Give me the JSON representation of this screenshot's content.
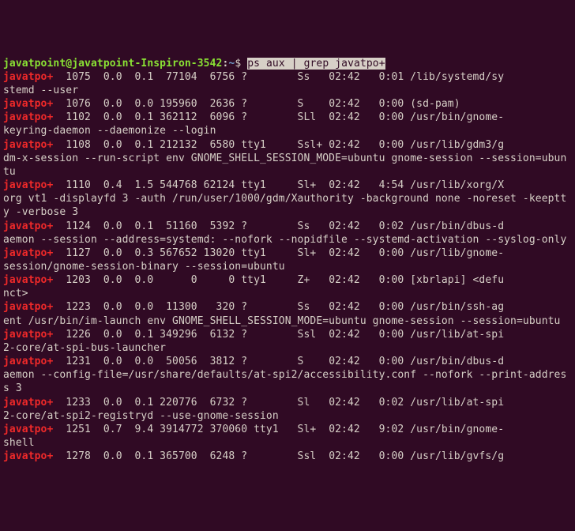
{
  "prompt": {
    "userhost": "javatpoint@javatpoint-Inspiron-3542",
    "colon": ":",
    "path": "~",
    "dollar": "$"
  },
  "cmd": {
    "ps": "ps",
    "space1": " ",
    "aux": "aux",
    "space2": " ",
    "pipe": "|",
    "space3": " ",
    "grep": "grep",
    "space4": " ",
    "javat": "javatpo+"
  },
  "r": [
    {
      "m": "javatpo+",
      "mid": "  1075  0.0  0.1  77104  6756 ?        Ss   02:42   0:01 /lib/systemd/sy",
      "rest": "stemd --user"
    },
    {
      "m": "javatpo+",
      "mid": "  1076  0.0  0.0 195960  2636 ?        S    02:42   0:00 (sd-pam)",
      "rest": ""
    },
    {
      "m": "javatpo+",
      "mid": "  1102  0.0  0.1 362112  6096 ?        SLl  02:42   0:00 /usr/bin/gnome-",
      "rest": "keyring-daemon --daemonize --login"
    },
    {
      "m": "javatpo+",
      "mid": "  1108  0.0  0.1 212132  6580 tty1     Ssl+ 02:42   0:00 /usr/lib/gdm3/g",
      "rest": "dm-x-session --run-script env GNOME_SHELL_SESSION_MODE=ubuntu gnome-session --session=ubuntu"
    },
    {
      "m": "javatpo+",
      "mid": "  1110  0.4  1.5 544768 62124 tty1     Sl+  02:42   4:54 /usr/lib/xorg/X",
      "rest": "org vt1 -displayfd 3 -auth /run/user/1000/gdm/Xauthority -background none -noreset -keeptty -verbose 3"
    },
    {
      "m": "javatpo+",
      "mid": "  1124  0.0  0.1  51160  5392 ?        Ss   02:42   0:02 /usr/bin/dbus-d",
      "rest": "aemon --session --address=systemd: --nofork --nopidfile --systemd-activation --syslog-only"
    },
    {
      "m": "javatpo+",
      "mid": "  1127  0.0  0.3 567652 13020 tty1     Sl+  02:42   0:00 /usr/lib/gnome-",
      "rest": "session/gnome-session-binary --session=ubuntu"
    },
    {
      "m": "javatpo+",
      "mid": "  1203  0.0  0.0      0     0 tty1     Z+   02:42   0:00 [xbrlapi] <defu",
      "rest": "nct>"
    },
    {
      "m": "javatpo+",
      "mid": "  1223  0.0  0.0  11300   320 ?        Ss   02:42   0:00 /usr/bin/ssh-ag",
      "rest": "ent /usr/bin/im-launch env GNOME_SHELL_SESSION_MODE=ubuntu gnome-session --session=ubuntu"
    },
    {
      "m": "javatpo+",
      "mid": "  1226  0.0  0.1 349296  6132 ?        Ssl  02:42   0:00 /usr/lib/at-spi",
      "rest": "2-core/at-spi-bus-launcher"
    },
    {
      "m": "javatpo+",
      "mid": "  1231  0.0  0.0  50056  3812 ?        S    02:42   0:00 /usr/bin/dbus-d",
      "rest": "aemon --config-file=/usr/share/defaults/at-spi2/accessibility.conf --nofork --print-address 3"
    },
    {
      "m": "javatpo+",
      "mid": "  1233  0.0  0.1 220776  6732 ?        Sl   02:42   0:02 /usr/lib/at-spi",
      "rest": "2-core/at-spi2-registryd --use-gnome-session"
    },
    {
      "m": "javatpo+",
      "mid": "  1251  0.7  9.4 3914772 370060 tty1   Sl+  02:42   9:02 /usr/bin/gnome-",
      "rest": "shell"
    },
    {
      "m": "javatpo+",
      "mid": "  1278  0.0  0.1 365700  6248 ?        Ssl  02:42   0:00 /usr/lib/gvfs/g",
      "rest": ""
    }
  ]
}
